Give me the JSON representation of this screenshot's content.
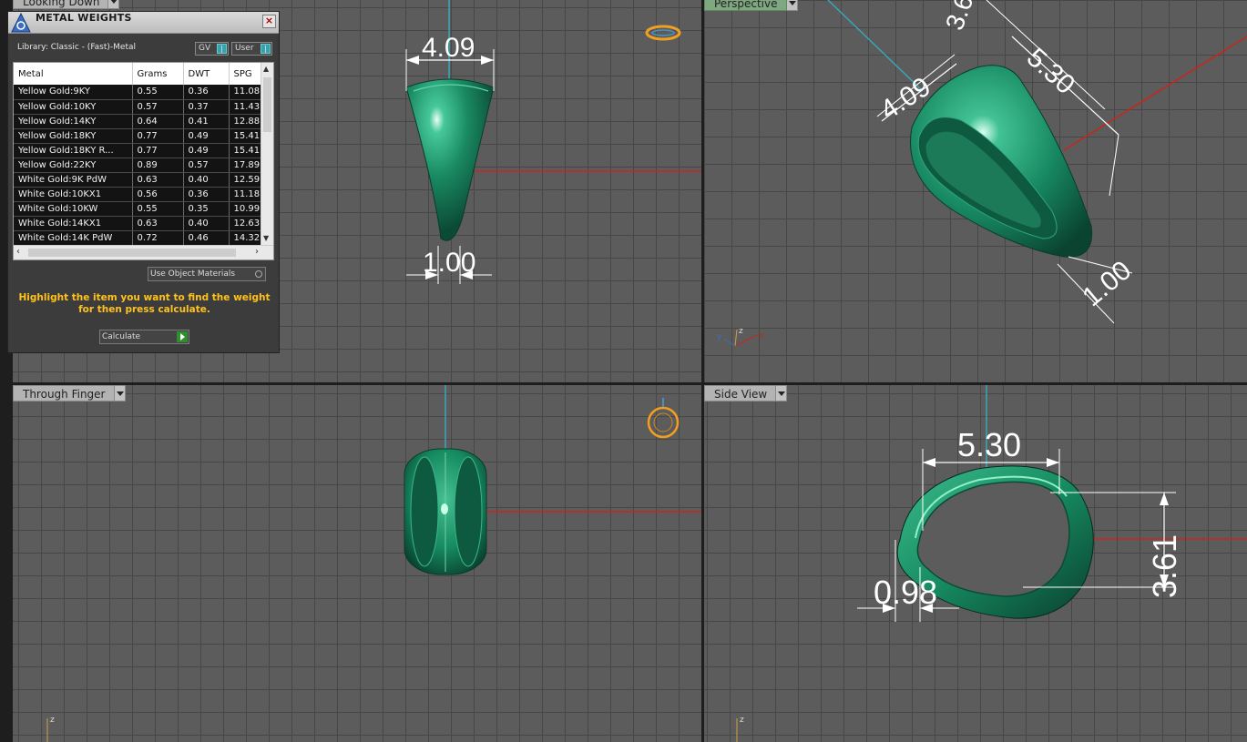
{
  "viewports": {
    "top_left": {
      "label": "Looking Down"
    },
    "top_right": {
      "label": "Perspective"
    },
    "bottom_left": {
      "label": "Through Finger"
    },
    "bottom_right": {
      "label": "Side View"
    }
  },
  "dimensions": {
    "top_view_width": "4.09",
    "top_view_bottom": "1.00",
    "persp_width": "4.09",
    "persp_length": "5.30",
    "persp_height": "3.6",
    "persp_bottom": "1.00",
    "side_length": "5.30",
    "side_height": "3.61",
    "side_thickness": "0.98"
  },
  "axis_labels": {
    "x": "x",
    "y": "y",
    "z": "z"
  },
  "metal_panel": {
    "title": "METAL WEIGHTS",
    "close_label": "×",
    "library_label": "Library: Classic - (Fast)-Metal",
    "toggle_gv": "GV",
    "toggle_user": "User",
    "columns": [
      "Metal",
      "Grams",
      "DWT",
      "SPG"
    ],
    "rows": [
      [
        "Yellow Gold:9KY",
        "0.55",
        "0.36",
        "11.08"
      ],
      [
        "Yellow Gold:10KY",
        "0.57",
        "0.37",
        "11.43"
      ],
      [
        "Yellow Gold:14KY",
        "0.64",
        "0.41",
        "12.88"
      ],
      [
        "Yellow Gold:18KY",
        "0.77",
        "0.49",
        "15.41"
      ],
      [
        "Yellow Gold:18KY R...",
        "0.77",
        "0.49",
        "15.41"
      ],
      [
        "Yellow Gold:22KY",
        "0.89",
        "0.57",
        "17.89"
      ],
      [
        "White Gold:9K PdW",
        "0.63",
        "0.40",
        "12.59"
      ],
      [
        "White Gold:10KX1",
        "0.56",
        "0.36",
        "11.18"
      ],
      [
        "White Gold:10KW",
        "0.55",
        "0.35",
        "10.99"
      ],
      [
        "White Gold:14KX1",
        "0.63",
        "0.40",
        "12.63"
      ],
      [
        "White Gold:14K PdW",
        "0.72",
        "0.46",
        "14.32"
      ]
    ],
    "use_object_materials": "Use Object Materials",
    "hint": "Highlight the item you want to find the weight for then press calculate.",
    "calculate_label": "Calculate"
  },
  "colors": {
    "ring_green": "#1f8a66",
    "axis_red": "#c8261c",
    "axis_cyan": "#3aa6b8",
    "hint_yellow": "#ffc21c",
    "gizmo_orange": "#f0a020"
  }
}
